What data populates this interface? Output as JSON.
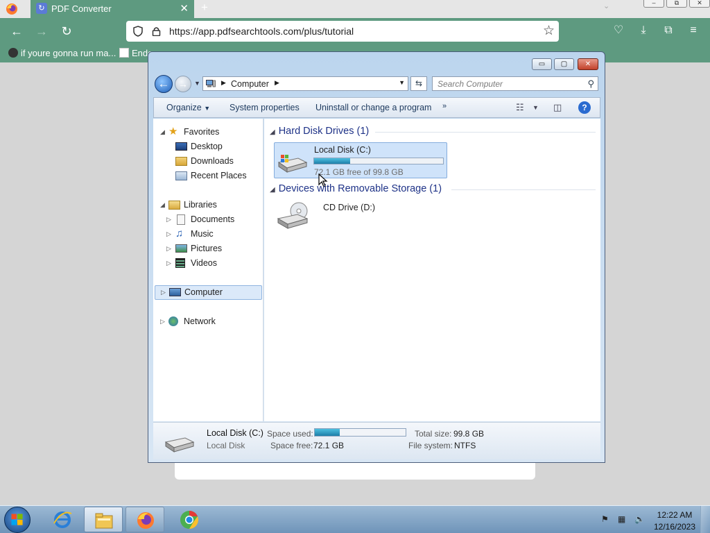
{
  "browser": {
    "tab": {
      "title": "PDF Converter",
      "close": "✕"
    },
    "new_tab": "+",
    "window_controls": {
      "min": "–",
      "max": "⧉",
      "close": "✕"
    },
    "nav": {
      "back": "←",
      "forward": "→",
      "reload": "↻"
    },
    "url": "https://app.pdfsearchtools.com/plus/tutorial",
    "bookmarks": [
      {
        "label": "if youre gonna run ma...",
        "icon": "webcompat-icon"
      },
      {
        "label": "Ende",
        "icon": "page-icon"
      }
    ],
    "toolbar_icons": [
      "pocket-icon",
      "download-icon",
      "extensions-icon",
      "menu-icon"
    ]
  },
  "explorer": {
    "title_buttons": {
      "min": "▭",
      "max": "▢",
      "close": "✕"
    },
    "address": {
      "crumb": "Computer"
    },
    "search_placeholder": "Search Computer",
    "commands": {
      "organize": "Organize",
      "system_properties": "System properties",
      "uninstall": "Uninstall or change a program",
      "more": "»"
    },
    "nav_tree": {
      "favorites": {
        "label": "Favorites",
        "items": [
          "Desktop",
          "Downloads",
          "Recent Places"
        ]
      },
      "libraries": {
        "label": "Libraries",
        "items": [
          "Documents",
          "Music",
          "Pictures",
          "Videos"
        ]
      },
      "computer": "Computer",
      "network": "Network"
    },
    "groups": {
      "hdd": {
        "header": "Hard Disk Drives (1)"
      },
      "removable": {
        "header": "Devices with Removable Storage (1)"
      }
    },
    "drive_c": {
      "name": "Local Disk (C:)",
      "free_text": "72.1 GB free of 99.8 GB",
      "used_fraction": 0.278
    },
    "drive_d": {
      "name": "CD Drive (D:)"
    },
    "details": {
      "name": "Local Disk (C:)",
      "type": "Local Disk",
      "space_used_label": "Space used:",
      "space_free_label": "Space free:",
      "space_free_value": "72.1 GB",
      "total_size_label": "Total size:",
      "total_size_value": "99.8 GB",
      "file_system_label": "File system:",
      "file_system_value": "NTFS",
      "used_fraction": 0.278
    }
  },
  "taskbar": {
    "apps": [
      "internet-explorer-icon",
      "windows-explorer-icon",
      "firefox-icon",
      "chrome-icon"
    ],
    "clock": {
      "time": "12:22 AM",
      "date": "12/16/2023"
    }
  },
  "colors": {
    "firefox_accent": "#5e9a80",
    "taskbar": "#8aaac9",
    "progress": "#1d7ea8"
  }
}
